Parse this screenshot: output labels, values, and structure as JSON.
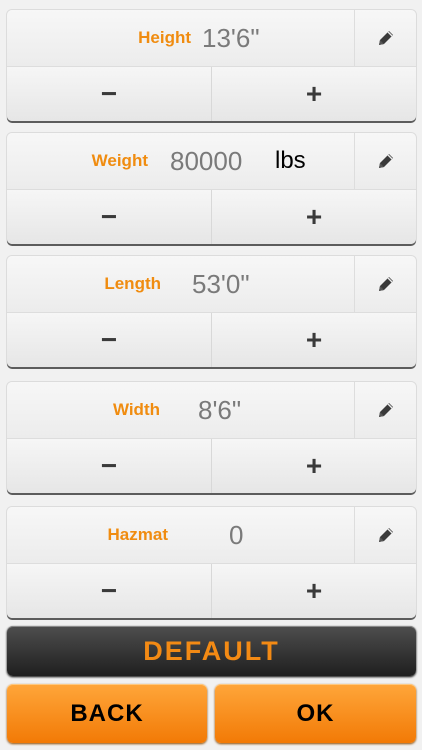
{
  "fields": [
    {
      "label": "Height",
      "value": "13'6\"",
      "unit": ""
    },
    {
      "label": "Weight",
      "value": "80000",
      "unit": "lbs"
    },
    {
      "label": "Length",
      "value": "53'0\"",
      "unit": ""
    },
    {
      "label": "Width",
      "value": "8'6\"",
      "unit": ""
    },
    {
      "label": "Hazmat",
      "value": "0",
      "unit": ""
    }
  ],
  "stepper": {
    "minus": "−",
    "plus": "+"
  },
  "buttons": {
    "default_label": "DEFAULT",
    "back_label": "BACK",
    "ok_label": "OK"
  },
  "icons": {
    "edit": "pencil-icon"
  },
  "colors": {
    "label_orange": "#f08c10",
    "value_gray": "#7a7a7a",
    "action_orange": "#f98c1f",
    "default_dark": "#2b2b2b"
  }
}
